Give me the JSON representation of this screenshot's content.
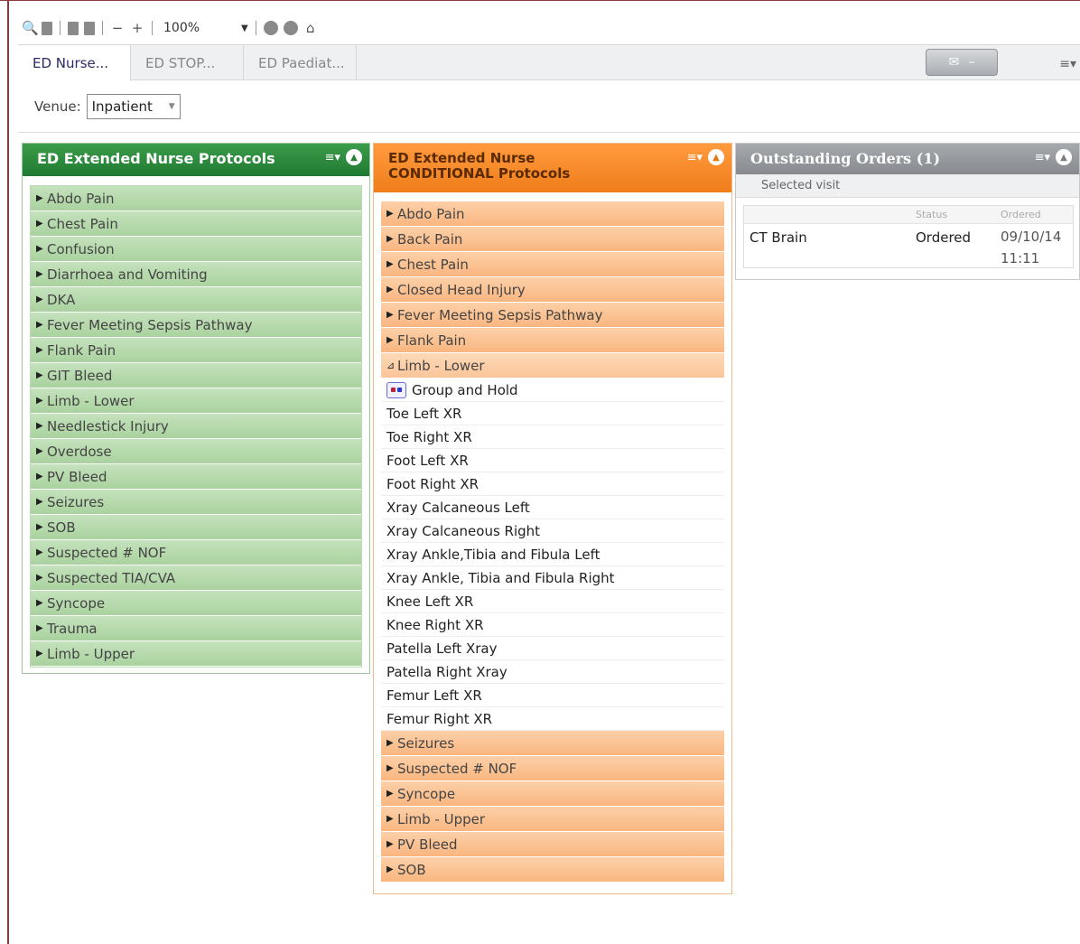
{
  "toolbar": {
    "zoom": "100%"
  },
  "tabs": [
    "ED Nurse...",
    "ED STOP...",
    "ED Paediat..."
  ],
  "venue": {
    "label": "Venue:",
    "value": "Inpatient"
  },
  "panel_green": {
    "title": "ED Extended Nurse Protocols",
    "items": [
      "Abdo Pain",
      "Chest Pain",
      "Confusion",
      "Diarrhoea and Vomiting",
      "DKA",
      "Fever Meeting Sepsis Pathway",
      "Flank Pain",
      "GIT Bleed",
      "Limb - Lower",
      "Needlestick Injury",
      "Overdose",
      "PV Bleed",
      "Seizures",
      "SOB",
      "Suspected # NOF",
      "Suspected TIA/CVA",
      "Syncope",
      "Trauma",
      "Limb - Upper"
    ]
  },
  "panel_orange": {
    "title_line1": "ED Extended Nurse",
    "title_line2": "CONDITIONAL Protocols",
    "categories_before": [
      "Abdo Pain",
      "Back Pain",
      "Chest Pain",
      "Closed Head Injury",
      "Fever Meeting Sepsis Pathway",
      "Flank Pain"
    ],
    "expanded": "Limb - Lower",
    "group_hold": "Group and Hold",
    "orders": [
      "Toe Left XR",
      "Toe Right XR",
      "Foot Left XR",
      "Foot Right XR",
      "Xray Calcaneous Left",
      "Xray Calcaneous Right",
      "Xray Ankle,Tibia and Fibula Left",
      "Xray Ankle, Tibia and Fibula Right",
      "Knee Left XR",
      "Knee Right XR",
      "Patella Left Xray",
      "Patella Right Xray",
      "Femur Left XR",
      "Femur Right XR"
    ],
    "categories_after": [
      "Seizures",
      "Suspected # NOF",
      "Syncope",
      "Limb - Upper",
      "PV Bleed",
      "SOB"
    ]
  },
  "panel_grey": {
    "title": "Outstanding Orders (1)",
    "subtitle": "Selected visit",
    "columns": [
      "",
      "Status",
      "Ordered"
    ],
    "rows": [
      {
        "name": "CT Brain",
        "status": "Ordered",
        "date": "09/10/14",
        "time": "11:11"
      }
    ]
  },
  "colors": {
    "green_header": "#1f7a31",
    "orange_header": "#f07d1a",
    "grey_header": "#868a8f"
  }
}
